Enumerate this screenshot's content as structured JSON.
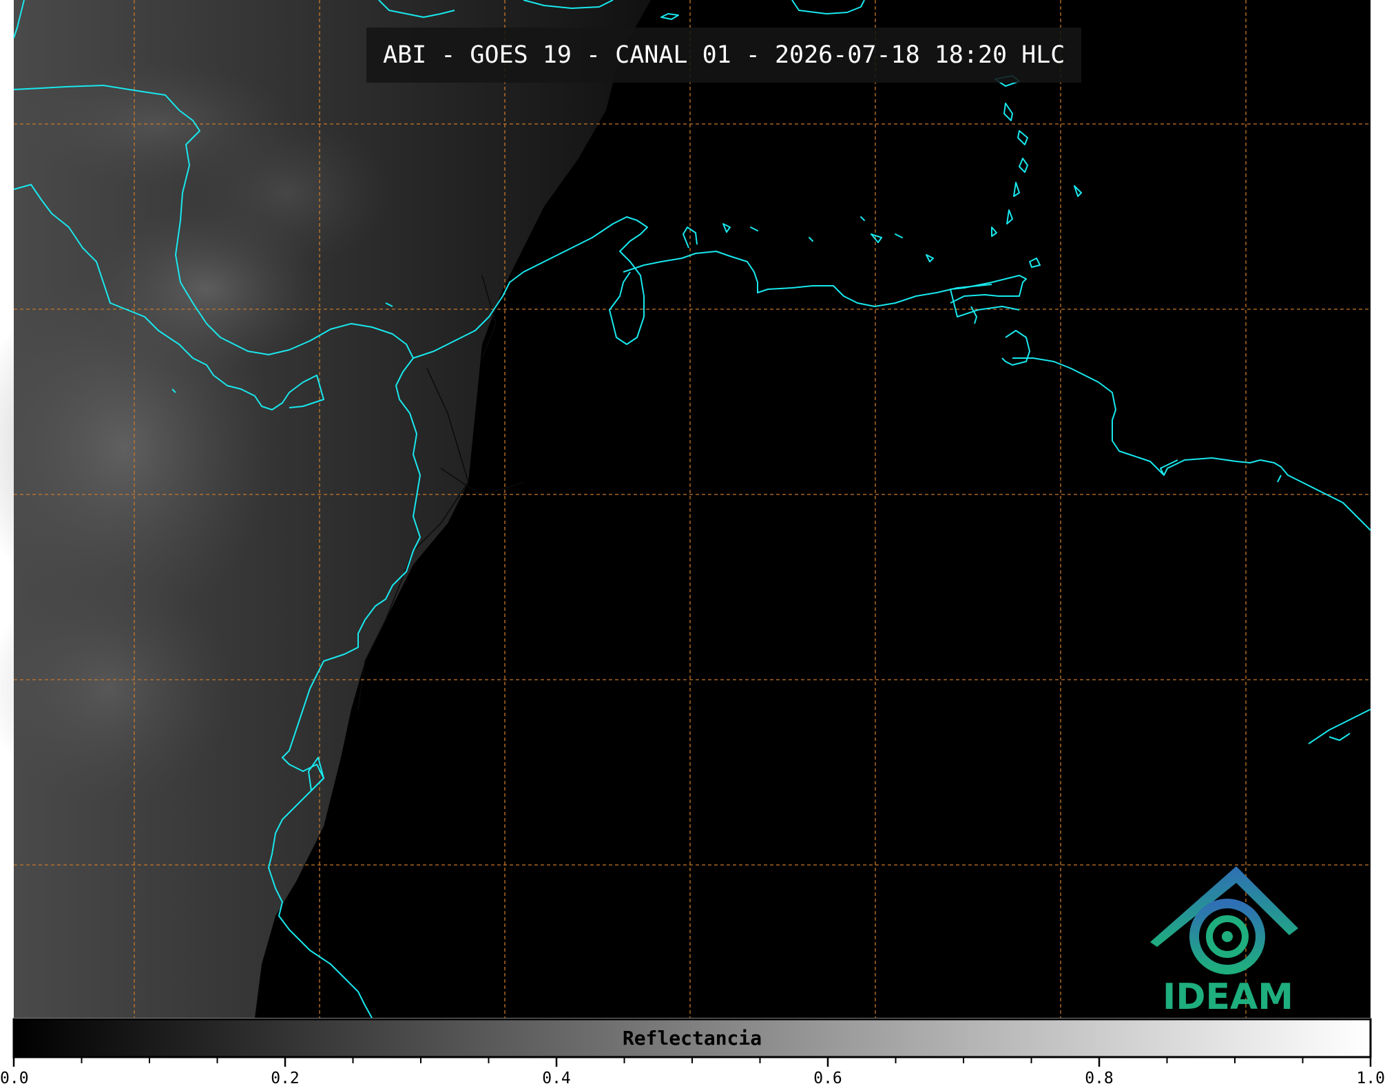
{
  "title": "ABI - GOES 19 - CANAL 01 - 2026-07-18 18:20 HLC",
  "logo": {
    "text": "IDEAM",
    "icon": "ideam-swirl-logo"
  },
  "colorbar": {
    "label": "Reflectancia",
    "range": [
      0.0,
      1.0
    ],
    "major_ticks": [
      "0.0",
      "0.2",
      "0.4",
      "0.6",
      "0.8",
      "1.0"
    ],
    "minor_step": 0.05
  },
  "colors": {
    "coastline": "#19e8ee",
    "graticule": "#c8782c",
    "background": "#000000",
    "borders": "#0b0b0b",
    "logo_text": "#1fae7e"
  },
  "map_layers": [
    "satellite-reflectance",
    "coastlines",
    "country-borders",
    "lat-lon-grid"
  ]
}
